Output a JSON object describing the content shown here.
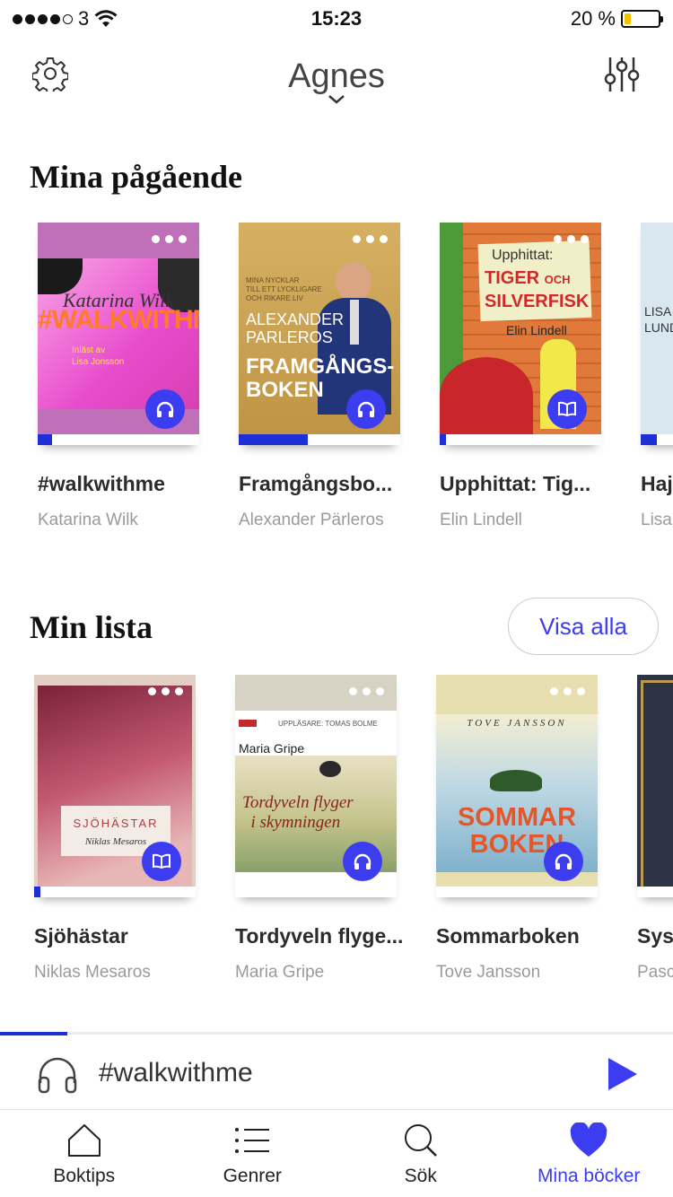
{
  "status_bar": {
    "carrier": "3",
    "time": "15:23",
    "battery": "20 %",
    "battery_fraction": 0.2
  },
  "header": {
    "profile_name": "Agnes"
  },
  "ongoing": {
    "title": "Mina pågående",
    "books": [
      {
        "title": "#walkwithme",
        "author": "Katarina Wilk",
        "format": "audio",
        "progress": 0.09,
        "cover_bg": "#c070b8"
      },
      {
        "title": "Framgångsbo...",
        "author": "Alexander Pärleros",
        "format": "audio",
        "progress": 0.43,
        "cover_bg": "#c9a450"
      },
      {
        "title": "Upphittat: Tig...",
        "author": "Elin Lindell",
        "format": "ebook",
        "progress": 0.04,
        "cover_bg": "#e07a35"
      },
      {
        "title": "Haj",
        "author": "Lisa",
        "format": "audio",
        "progress": 0.1,
        "cover_bg": "#d8e8ee"
      }
    ]
  },
  "mylist": {
    "title": "Min lista",
    "view_all": "Visa alla",
    "books": [
      {
        "title": "Sjöhästar",
        "author": "Niklas Mesaros",
        "format": "ebook",
        "progress": 0.04,
        "cover_bg": "#b5506a"
      },
      {
        "title": "Tordyveln flyge...",
        "author": "Maria Gripe",
        "format": "audio",
        "progress": 0,
        "cover_bg": "#d7d3c4"
      },
      {
        "title": "Sommarboken",
        "author": "Tove Jansson",
        "format": "audio",
        "progress": 0,
        "cover_bg": "#e8dfb0"
      },
      {
        "title": "Sys",
        "author": "Pasc",
        "format": "ebook",
        "progress": 0,
        "cover_bg": "#2b3345"
      }
    ]
  },
  "player": {
    "now_playing": "#walkwithme",
    "progress": 0.1
  },
  "tabs": [
    {
      "label": "Boktips",
      "icon": "home-icon"
    },
    {
      "label": "Genrer",
      "icon": "list-icon"
    },
    {
      "label": "Sök",
      "icon": "search-icon"
    },
    {
      "label": "Mina böcker",
      "icon": "heart-icon",
      "active": true
    }
  ],
  "colors": {
    "accent": "#3c3cf0",
    "progress": "#1e2fd8"
  }
}
